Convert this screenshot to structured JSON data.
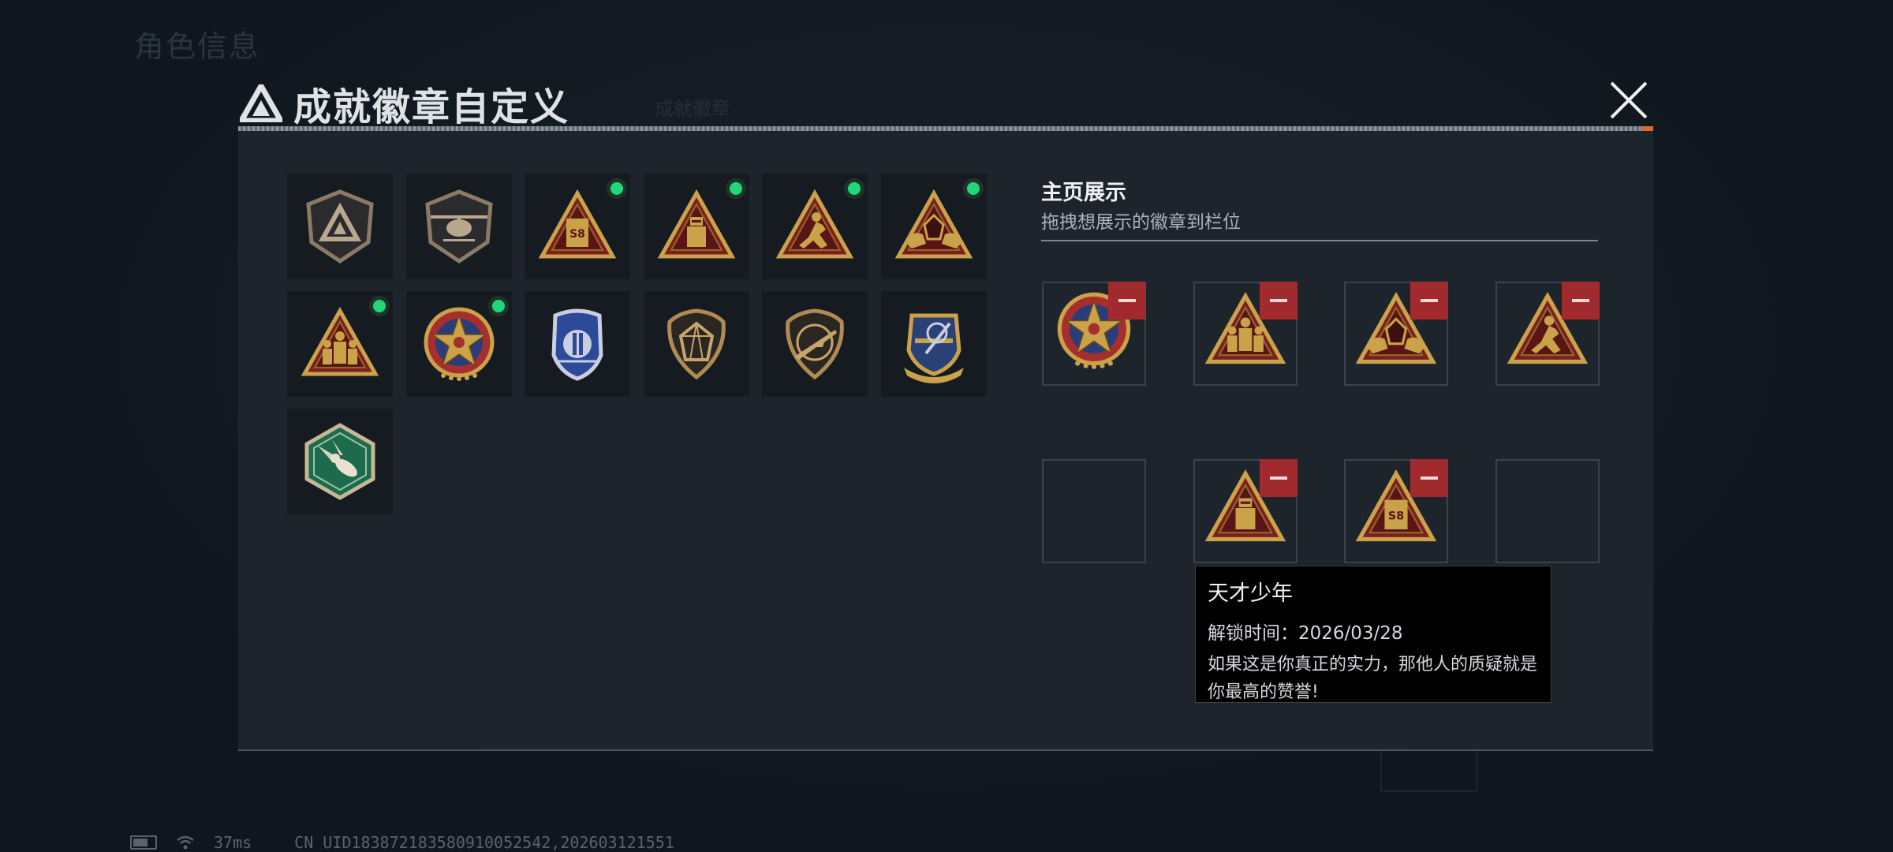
{
  "background": {
    "title": "角色信息",
    "tab": "成就徽章"
  },
  "dialog": {
    "title": "成就徽章自定义",
    "close_label": "close"
  },
  "badges": [
    {
      "name": "base-shield",
      "icon": "shield-triangle-icon",
      "dot": false
    },
    {
      "name": "helicopter",
      "icon": "helicopter-shield-icon",
      "dot": false
    },
    {
      "name": "s8",
      "icon": "triangle-s8-icon",
      "dot": true
    },
    {
      "name": "genius",
      "icon": "triangle-robot-icon",
      "dot": true
    },
    {
      "name": "runner",
      "icon": "triangle-runner-icon",
      "dot": true
    },
    {
      "name": "hands-diamond",
      "icon": "triangle-hands-icon",
      "dot": true
    },
    {
      "name": "squad",
      "icon": "triangle-squad-icon",
      "dot": true
    },
    {
      "name": "star-medal",
      "icon": "star-medal-icon",
      "dot": true
    },
    {
      "name": "police",
      "icon": "police-badge-icon",
      "dot": false
    },
    {
      "name": "gem-shield",
      "icon": "gem-shield-icon",
      "dot": false
    },
    {
      "name": "rifle-shield",
      "icon": "rifle-shield-icon",
      "dot": false
    },
    {
      "name": "crest",
      "icon": "crest-shield-icon",
      "dot": false
    },
    {
      "name": "wasp",
      "icon": "hexagon-wasp-icon",
      "dot": false
    }
  ],
  "showcase": {
    "title": "主页展示",
    "subtitle": "拖拽想展示的徽章到栏位",
    "slots": [
      {
        "icon": "star-medal-icon",
        "filled": true
      },
      {
        "icon": "triangle-squad-icon",
        "filled": true
      },
      {
        "icon": "triangle-hands-icon",
        "filled": true
      },
      {
        "icon": "triangle-runner-icon",
        "filled": true
      },
      {
        "icon": "",
        "filled": false
      },
      {
        "icon": "triangle-robot-icon",
        "filled": true
      },
      {
        "icon": "triangle-s8-icon",
        "filled": true
      },
      {
        "icon": "",
        "filled": false
      }
    ]
  },
  "tooltip": {
    "name": "天才少年",
    "unlock_time": "解锁时间：2026/03/28",
    "description": "如果这是你真正的实力，那他人的质疑就是你最高的赞誉!"
  },
  "status_bar": {
    "ping": "37ms",
    "uid": "CN UID1838721835809100525​42,202603121551"
  },
  "colors": {
    "gold": "#c9a24a",
    "red": "#7d1f1f",
    "green_dot": "#22d67b",
    "remove_red": "#a12a2f"
  }
}
